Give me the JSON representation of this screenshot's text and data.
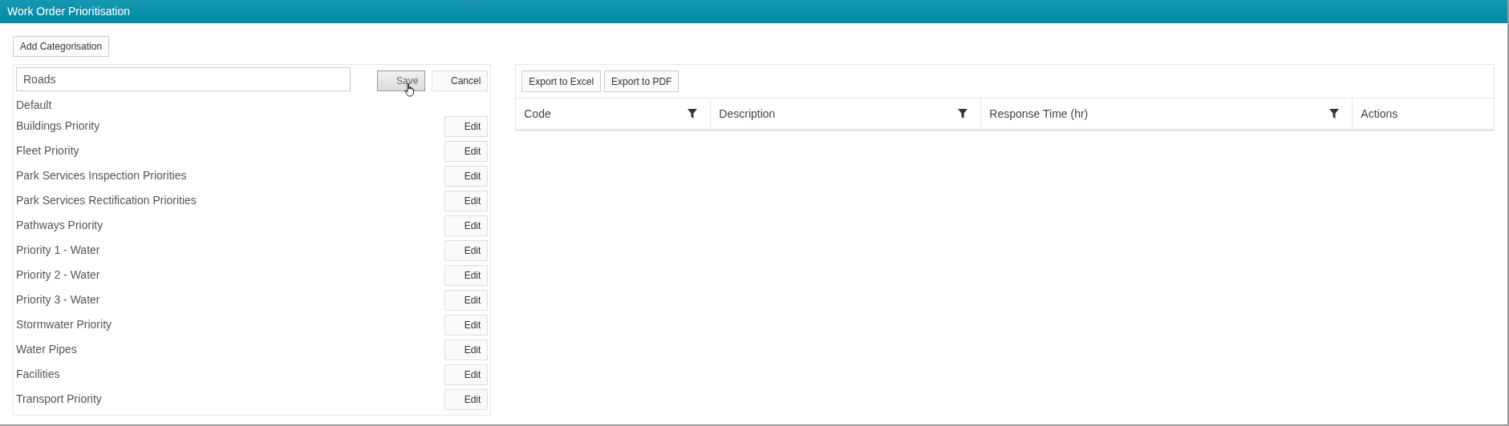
{
  "window": {
    "title": "Work Order Prioritisation"
  },
  "add_button": "Add Categorisation",
  "editor": {
    "value": "Roads",
    "buttons": [
      {
        "label": "Save",
        "hovered": true
      },
      {
        "label": "Cancel",
        "hovered": false
      }
    ]
  },
  "default_label": "Default",
  "categories": [
    {
      "name": "Buildings Priority",
      "action": "Edit"
    },
    {
      "name": "Fleet Priority",
      "action": "Edit"
    },
    {
      "name": "Park Services Inspection Priorities",
      "action": "Edit"
    },
    {
      "name": "Park Services Rectification Priorities",
      "action": "Edit"
    },
    {
      "name": "Pathways Priority",
      "action": "Edit"
    },
    {
      "name": "Priority 1 - Water",
      "action": "Edit"
    },
    {
      "name": "Priority 2 - Water",
      "action": "Edit"
    },
    {
      "name": "Priority 3 - Water",
      "action": "Edit"
    },
    {
      "name": "Stormwater Priority",
      "action": "Edit"
    },
    {
      "name": "Water Pipes",
      "action": "Edit"
    },
    {
      "name": "Facilities",
      "action": "Edit"
    },
    {
      "name": "Transport Priority",
      "action": "Edit"
    }
  ],
  "toolbar": [
    "Export to Excel",
    "Export to PDF"
  ],
  "table": {
    "columns": [
      {
        "label": "Code",
        "filterable": true
      },
      {
        "label": "Description",
        "filterable": true
      },
      {
        "label": "Response Time (hr)",
        "filterable": true
      },
      {
        "label": "Actions",
        "filterable": false
      }
    ]
  }
}
